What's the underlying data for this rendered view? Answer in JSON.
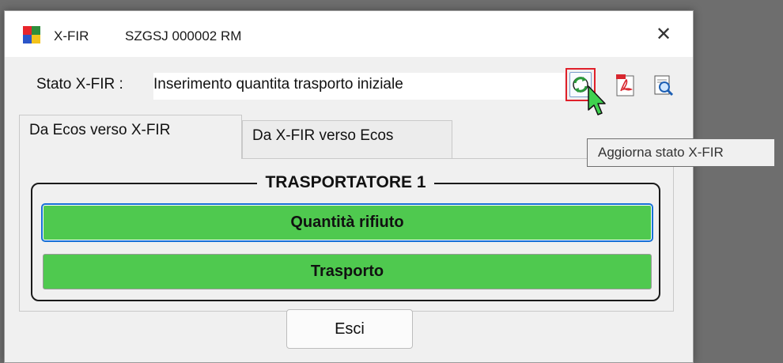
{
  "window": {
    "app_name": "X-FIR",
    "document_code": "SZGSJ 000002 RM",
    "close_glyph": "✕"
  },
  "status": {
    "label": "Stato X-FIR :",
    "value": "Inserimento quantita trasporto iniziale"
  },
  "toolbar": {
    "refresh_icon": "refresh-status-icon",
    "pdf_icon": "pdf-icon",
    "search_icon": "document-search-icon",
    "highlight_color": "#e0202a"
  },
  "tooltip": {
    "text": "Aggiorna stato X-FIR"
  },
  "tabs": [
    {
      "label": "Da Ecos verso X-FIR",
      "active": true
    },
    {
      "label": "Da X-FIR verso Ecos",
      "active": false
    }
  ],
  "group": {
    "title": "TRASPORTATORE 1",
    "buttons": [
      {
        "label": "Quantità rifiuto"
      },
      {
        "label": "Trasporto"
      }
    ],
    "button_color": "#4fc94f"
  },
  "footer": {
    "exit_label": "Esci"
  }
}
